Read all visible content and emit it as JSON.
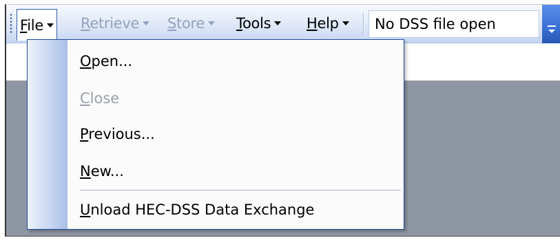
{
  "menubar": {
    "items": [
      {
        "label": "File",
        "state": "open"
      },
      {
        "label": "Retrieve",
        "state": "disabled"
      },
      {
        "label": "Store",
        "state": "disabled"
      },
      {
        "label": "Tools",
        "state": "enabled"
      },
      {
        "label": "Help",
        "state": "enabled"
      }
    ]
  },
  "status": {
    "dss_file": "No DSS file open"
  },
  "file_menu": {
    "items": [
      {
        "label": "Open...",
        "enabled": true
      },
      {
        "label": "Close",
        "enabled": false
      },
      {
        "label": "Previous...",
        "enabled": true
      },
      {
        "label": "New...",
        "enabled": true
      },
      {
        "label": "Unload HEC-DSS Data Exchange",
        "enabled": true
      }
    ]
  },
  "colors": {
    "toolbar_top": "#f7f9fd",
    "toolbar_bottom": "#c6d6f1",
    "menu_border": "#1c4c9c",
    "disabled_text": "#95a1bd",
    "workspace": "#8f96a3",
    "overflow_button": "#3a6fd4"
  },
  "icons": {
    "grip": "toolbar-grip-icon",
    "caret": "dropdown-caret-icon",
    "overflow": "toolbar-overflow-chevron-icon"
  }
}
